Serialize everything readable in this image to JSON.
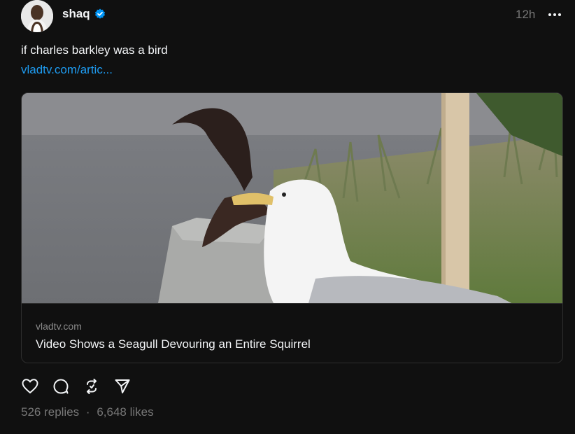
{
  "post": {
    "author": "shaq",
    "time": "12h",
    "caption": "if charles barkley was a bird",
    "link_text": "vladtv.com/artic..."
  },
  "card": {
    "domain": "vladtv.com",
    "title": "Video Shows a Seagull Devouring an Entire Squirrel"
  },
  "stats": {
    "replies": "526 replies",
    "separator": "·",
    "likes": "6,648 likes"
  },
  "icons": {
    "verified": "verified-badge-icon",
    "more": "more-options-icon",
    "like": "heart-icon",
    "reply": "comment-bubble-icon",
    "repost": "repost-icon",
    "share": "share-send-icon"
  },
  "colors": {
    "background": "#101010",
    "link": "#1e9bf0",
    "verified": "#0095f6"
  }
}
